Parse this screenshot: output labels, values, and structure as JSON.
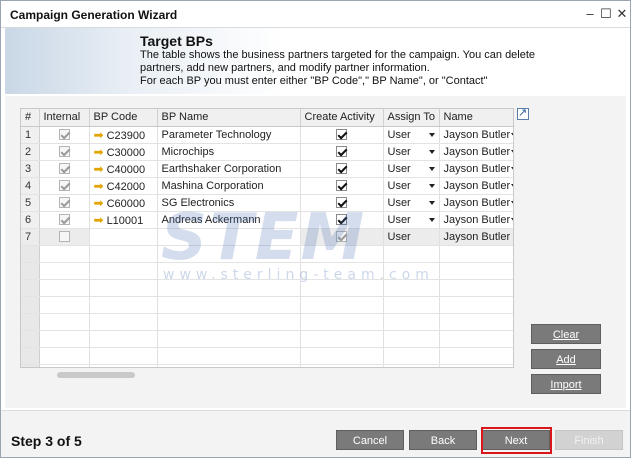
{
  "window": {
    "title": "Campaign Generation Wizard"
  },
  "titlebar_glyphs": {
    "minimize": "–",
    "maximize": "☐",
    "close": "✕"
  },
  "header": {
    "title": "Target BPs",
    "lines": [
      "The table shows the business partners targeted for the campaign. You can delete",
      "partners, add new partners, and modify partner information.",
      "For each BP you must enter either \"BP Code\",\" BP Name\", or \"Contact\""
    ]
  },
  "table": {
    "columns": [
      "#",
      "Internal",
      "BP Code",
      "BP Name",
      "Create Activity",
      "Assign To",
      "Name"
    ],
    "rows": [
      {
        "num": "1",
        "internal": true,
        "bp_code": "C23900",
        "bp_name": "Parameter Technology",
        "create_activity": true,
        "assign_to": "User",
        "name": "Jayson Butler"
      },
      {
        "num": "2",
        "internal": true,
        "bp_code": "C30000",
        "bp_name": "Microchips",
        "create_activity": true,
        "assign_to": "User",
        "name": "Jayson Butler"
      },
      {
        "num": "3",
        "internal": true,
        "bp_code": "C40000",
        "bp_name": "Earthshaker Corporation",
        "create_activity": true,
        "assign_to": "User",
        "name": "Jayson Butler"
      },
      {
        "num": "4",
        "internal": true,
        "bp_code": "C42000",
        "bp_name": "Mashina Corporation",
        "create_activity": true,
        "assign_to": "User",
        "name": "Jayson Butler"
      },
      {
        "num": "5",
        "internal": true,
        "bp_code": "C60000",
        "bp_name": "SG Electronics",
        "create_activity": true,
        "assign_to": "User",
        "name": "Jayson Butler"
      },
      {
        "num": "6",
        "internal": true,
        "bp_code": "L10001",
        "bp_name": "Andreas Ackermann",
        "create_activity": true,
        "assign_to": "User",
        "name": "Jayson Butler"
      },
      {
        "num": "7",
        "internal": false,
        "bp_code": "",
        "bp_name": "",
        "create_activity": true,
        "assign_to": "User",
        "name": "Jayson Butler"
      }
    ],
    "empty_rows": 8
  },
  "side_buttons": {
    "clear": "Clear",
    "add": "Add",
    "import": "Import"
  },
  "footer": {
    "step": "Step 3 of 5",
    "cancel": "Cancel",
    "back": "Back",
    "next": "Next",
    "finish": "Finish"
  },
  "watermark": {
    "big": "STEM",
    "small": "www.sterling-team.com"
  },
  "colors": {
    "button_bg": "#7a7a7a",
    "highlight": "#d8161b",
    "arrow": "#e2a400"
  }
}
